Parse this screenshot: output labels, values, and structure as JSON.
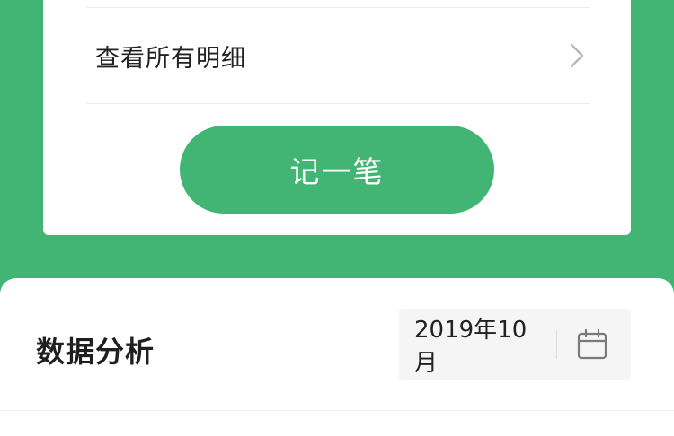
{
  "summary_card": {
    "detail_link_label": "查看所有明细",
    "record_button_label": "记一笔"
  },
  "analysis": {
    "title": "数据分析",
    "date_value": "2019年10月"
  },
  "colors": {
    "accent": "#42b575",
    "card": "#ffffff",
    "picker_bg": "#f5f5f5"
  },
  "icons": {
    "detail_chevron": "chevron-right-icon",
    "date_picker": "calendar-icon"
  }
}
